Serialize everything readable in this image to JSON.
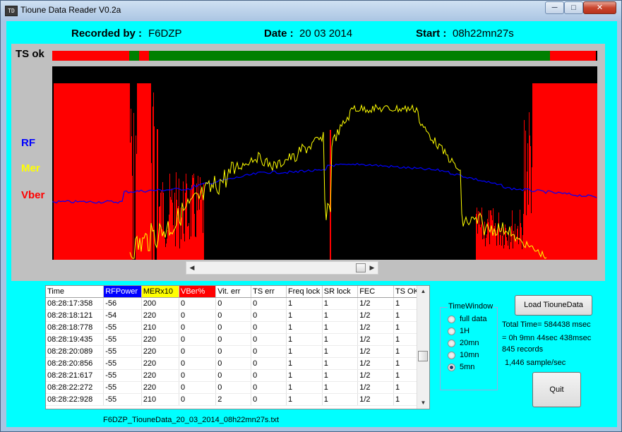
{
  "window": {
    "title": "Tioune Data Reader V0.2a",
    "icon_text": "TD"
  },
  "header": {
    "recorded_label": "Recorded by :",
    "recorded_value": "F6DZP",
    "date_label": "Date :",
    "date_value": "20 03 2014",
    "start_label": "Start :",
    "start_value": "08h22mn27s"
  },
  "plot": {
    "ts_label": "TS ok",
    "legend": [
      {
        "label": "RF",
        "color": "#0000ff"
      },
      {
        "label": "Mer",
        "color": "#ffff00"
      },
      {
        "label": "Vber",
        "color": "#ff0000"
      }
    ],
    "colors": {
      "ok": "#008000",
      "fail": "#ff0000",
      "bg": "#000000"
    }
  },
  "table": {
    "headers": [
      {
        "label": "Time",
        "bg": "#ffffff",
        "fg": "#000000"
      },
      {
        "label": "RFPower",
        "bg": "#0000ff",
        "fg": "#ffffff"
      },
      {
        "label": "MERx10",
        "bg": "#ffff00",
        "fg": "#000000"
      },
      {
        "label": "VBer%",
        "bg": "#ff0000",
        "fg": "#ffffff"
      },
      {
        "label": "Vit. err",
        "bg": "#ffffff",
        "fg": "#000000"
      },
      {
        "label": "TS err",
        "bg": "#ffffff",
        "fg": "#000000"
      },
      {
        "label": "Freq lock",
        "bg": "#ffffff",
        "fg": "#000000"
      },
      {
        "label": "SR lock",
        "bg": "#ffffff",
        "fg": "#000000"
      },
      {
        "label": "FEC",
        "bg": "#ffffff",
        "fg": "#000000"
      },
      {
        "label": "TS OK",
        "bg": "#ffffff",
        "fg": "#000000"
      }
    ],
    "rows": [
      [
        "08:28:17:358",
        "-56",
        "200",
        "0",
        "0",
        "0",
        "1",
        "1",
        "1/2",
        "1"
      ],
      [
        "08:28:18:121",
        "-54",
        "220",
        "0",
        "0",
        "0",
        "1",
        "1",
        "1/2",
        "1"
      ],
      [
        "08:28:18:778",
        "-55",
        "210",
        "0",
        "0",
        "0",
        "1",
        "1",
        "1/2",
        "1"
      ],
      [
        "08:28:19:435",
        "-55",
        "220",
        "0",
        "0",
        "0",
        "1",
        "1",
        "1/2",
        "1"
      ],
      [
        "08:28:20:089",
        "-55",
        "220",
        "0",
        "0",
        "0",
        "1",
        "1",
        "1/2",
        "1"
      ],
      [
        "08:28:20:856",
        "-55",
        "220",
        "0",
        "0",
        "0",
        "1",
        "1",
        "1/2",
        "1"
      ],
      [
        "08:28:21:617",
        "-55",
        "220",
        "0",
        "0",
        "0",
        "1",
        "1",
        "1/2",
        "1"
      ],
      [
        "08:28:22:272",
        "-55",
        "220",
        "0",
        "0",
        "0",
        "1",
        "1",
        "1/2",
        "1"
      ],
      [
        "08:28:22:928",
        "-55",
        "210",
        "0",
        "2",
        "0",
        "1",
        "1",
        "1/2",
        "1"
      ]
    ]
  },
  "filename": "F6DZP_TiouneData_20_03_2014_08h22mn27s.txt",
  "time_window": {
    "title": "TimeWindow",
    "options": [
      {
        "label": "full data",
        "selected": false
      },
      {
        "label": "1H",
        "selected": false
      },
      {
        "label": "20mn",
        "selected": false
      },
      {
        "label": "10mn",
        "selected": false
      },
      {
        "label": "5mn",
        "selected": true
      }
    ]
  },
  "actions": {
    "load_label": "Load TiouneData",
    "quit_label": "Quit"
  },
  "summary": {
    "total_time": "Total Time= 584438 msec",
    "duration": "= 0h 9mn 44sec 438msec",
    "records": "845 records",
    "rate": "1,446 sample/sec"
  }
}
